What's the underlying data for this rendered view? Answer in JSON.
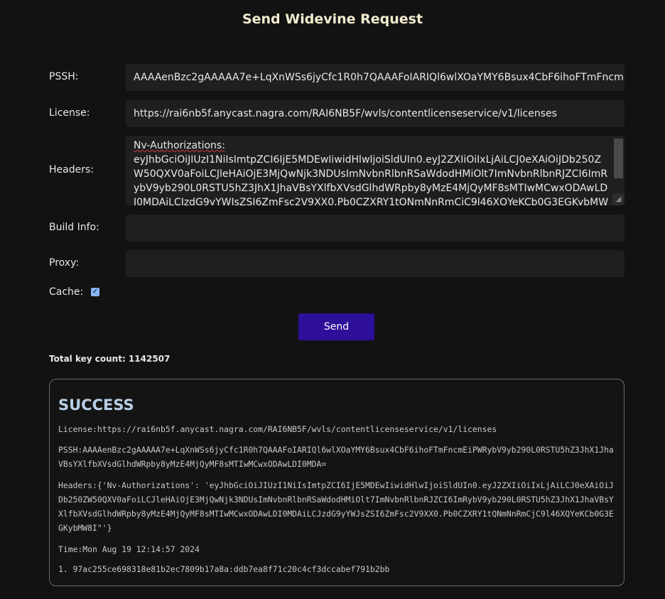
{
  "page": {
    "title": "Send Widevine Request"
  },
  "form": {
    "pssh_label": "PSSH:",
    "pssh_value": "AAAAenBzc2gAAAAA7e+LqXnWSs6jyCfc1R0h7QAAAFoIARIQl6wlXOaYMY6Bsux4CbF6ihoFTmFncmEiPWRybV9yb290L0RSTU5hZ3JhX1JhaVBsYXlfbXVsdGlhdWRpby8yMzE4MjQyMF8sMTIwMCwxODAwLDI0MDA=",
    "license_label": "License:",
    "license_value": "https://rai6nb5f.anycast.nagra.com/RAI6NB5F/wvls/contentlicenseservice/v1/licenses",
    "headers_label": "Headers:",
    "headers_key": "Nv-Authorizations:",
    "headers_value": "eyJhbGciOiJIUzI1NiIsImtpZCI6IjE5MDEwIiwidHlwIjoiSldUIn0.eyJ2ZXIiOiIxLjAiLCJ0eXAiOiJDb250ZW50QXV0aFoiLCJleHAiOjE3MjQwNjk3NDUsImNvbnRlbnRSaWdodHMiOlt7ImNvbnRlbnRJZCI6ImRybV9yb290L0RSTU5hZ3JhX1JhaVBsYXlfbXVsdGlhdWRpby8yMzE4MjQyMF8sMTIwMCwxODAwLDI0MDAiLCJzdG9yYWJsZSI6ZmFsc2V9XX0.Pb0CZXRY1tQNmNnRmCjC9l46XQYeKCb0G3EGKybMW8I",
    "build_info_label": "Build Info:",
    "build_info_value": "",
    "proxy_label": "Proxy:",
    "proxy_value": "",
    "cache_label": "Cache:",
    "cache_checked": true,
    "send_label": "Send"
  },
  "stats": {
    "total_key_count": "Total key count: 1142507"
  },
  "result": {
    "status": "SUCCESS",
    "license_line": "License:https://rai6nb5f.anycast.nagra.com/RAI6NB5F/wvls/contentlicenseservice/v1/licenses",
    "pssh_line": "PSSH:AAAAenBzc2gAAAAA7e+LqXnWSs6jyCfc1R0h7QAAAFoIARIQl6wlXOaYMY6Bsux4CbF6ihoFTmFncmEiPWRybV9yb290L0RSTU5hZ3JhX1JhaVBsYXlfbXVsdGlhdWRpby8yMzE4MjQyMF8sMTIwMCwxODAwLDI0MDA=",
    "headers_line": "Headers:{'Nv-Authorizations': 'eyJhbGciOiJIUzI1NiIsImtpZCI6IjE5MDEwIiwidHlwIjoiSldUIn0.eyJ2ZXIiOiIxLjAiLCJ0eXAiOiJDb250ZW50QXV0aFoiLCJleHAiOjE3MjQwNjk3NDUsImNvbnRlbnRSaWdodHMiOlt7ImNvbnRlbnRJZCI6ImRybV9yb290L0RSTU5hZ3JhX1JhaVBsYXlfbXVsdGlhdWRpby8yMzE4MjQyMF8sMTIwMCwxODAwLDI0MDAiLCJzdG9yYWJsZSI6ZmFsc2V9XX0.Pb0CZXRY1tQNmNnRmCjC9l46XQYeKCb0G3EGKybMW8I\"'}",
    "time_line": "Time:Mon Aug 19 12:14:57 2024",
    "keys": [
      "1. 97ac255ce698318e81b2ec7809b17a8a:ddb7ea8f71c20c4cf3dccabef791b2bb"
    ]
  },
  "colors": {
    "background": "#121212",
    "field_background": "#1f1f1f",
    "send_button": "#2e0f99",
    "title_text": "#f4ecd0",
    "status_text": "#b9cfe6"
  }
}
